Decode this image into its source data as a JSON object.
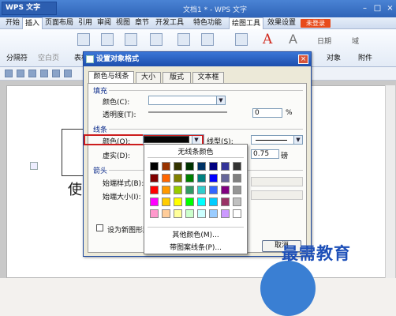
{
  "app": {
    "name": "WPS 文字",
    "doc_title": "文档1 * - WPS 文字",
    "unlogged": "未登录"
  },
  "menu": [
    "开始",
    "插入",
    "页面布局",
    "引用",
    "审阅",
    "视图",
    "章节",
    "开发工具",
    "特色功能",
    "绘图工具",
    "效果设置"
  ],
  "ribbon": {
    "separator_label": "分隔符",
    "blank_page_label": "空白页",
    "table_label": "表格",
    "date_label": "日期",
    "field_label": "域",
    "object_label": "对象",
    "attachment_label": "附件"
  },
  "document": {
    "visible_text": "使关"
  },
  "dialog": {
    "title": "设置对象格式",
    "tabs": [
      "颜色与线条",
      "大小",
      "版式",
      "文本框"
    ],
    "fill": {
      "group": "填充",
      "color_label": "颜色(C):",
      "transparency_label": "透明度(T):",
      "transparency_value": "0",
      "percent": "%"
    },
    "line": {
      "group": "线条",
      "color_label": "颜色(O):",
      "style_label": "线型(S):",
      "dash_label": "虚实(D):",
      "weight_value": "0.75",
      "weight_unit": "磅"
    },
    "arrows": {
      "group": "箭头",
      "begin_style_label": "始端样式(B):",
      "begin_size_label": "始端大小(I):"
    },
    "default_checkbox": "设为新图形默认",
    "cancel": "取消"
  },
  "color_popup": {
    "no_line": "无线条颜色",
    "more_colors": "其他颜色(M)...",
    "patterned_lines": "带图案线条(P)...",
    "swatches": [
      "#000000",
      "#993300",
      "#333300",
      "#003300",
      "#003366",
      "#000080",
      "#333399",
      "#333333",
      "#800000",
      "#ff6600",
      "#808000",
      "#008000",
      "#008080",
      "#0000ff",
      "#666699",
      "#808080",
      "#ff0000",
      "#ff9900",
      "#99cc00",
      "#339966",
      "#33cccc",
      "#3366ff",
      "#800080",
      "#969696",
      "#ff00ff",
      "#ffcc00",
      "#ffff00",
      "#00ff00",
      "#00ffff",
      "#00ccff",
      "#993366",
      "#c0c0c0",
      "#ff99cc",
      "#ffcc99",
      "#ffff99",
      "#ccffcc",
      "#ccffff",
      "#99ccff",
      "#cc99ff",
      "#ffffff"
    ]
  },
  "watermark": "最需教育",
  "colors": {
    "accent": "#2f64b8",
    "highlight": "#cc1d1d"
  }
}
